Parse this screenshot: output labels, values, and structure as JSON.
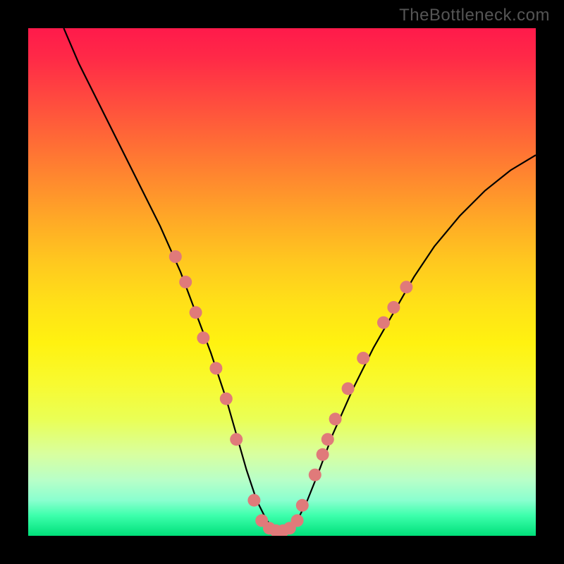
{
  "watermark": "TheBottleneck.com",
  "colors": {
    "curve_stroke": "#000000",
    "marker_fill": "#e07a7a",
    "marker_stroke": "#c86060",
    "frame_bg": "#000000"
  },
  "chart_data": {
    "type": "line",
    "title": "",
    "xlabel": "",
    "ylabel": "",
    "xlim": [
      0,
      100
    ],
    "ylim": [
      0,
      100
    ],
    "series": [
      {
        "name": "curve",
        "x": [
          7,
          10,
          14,
          18,
          22,
          26,
          30,
          33,
          36,
          39,
          41,
          43,
          45,
          47,
          49,
          51,
          53,
          55,
          57,
          60,
          64,
          68,
          72,
          76,
          80,
          85,
          90,
          95,
          100
        ],
        "values": [
          100,
          93,
          85,
          77,
          69,
          61,
          52,
          44,
          36,
          27,
          20,
          13,
          7,
          3,
          1,
          1,
          3,
          7,
          12,
          20,
          29,
          37,
          44,
          51,
          57,
          63,
          68,
          72,
          75
        ]
      }
    ],
    "markers": [
      {
        "x": 29,
        "y": 55
      },
      {
        "x": 31,
        "y": 50
      },
      {
        "x": 33,
        "y": 44
      },
      {
        "x": 34.5,
        "y": 39
      },
      {
        "x": 37,
        "y": 33
      },
      {
        "x": 39,
        "y": 27
      },
      {
        "x": 41,
        "y": 19
      },
      {
        "x": 44.5,
        "y": 7
      },
      {
        "x": 46,
        "y": 3
      },
      {
        "x": 47.5,
        "y": 1.5
      },
      {
        "x": 48.8,
        "y": 1
      },
      {
        "x": 50.2,
        "y": 1
      },
      {
        "x": 51.5,
        "y": 1.5
      },
      {
        "x": 53,
        "y": 3
      },
      {
        "x": 54,
        "y": 6
      },
      {
        "x": 56.5,
        "y": 12
      },
      {
        "x": 58,
        "y": 16
      },
      {
        "x": 59,
        "y": 19
      },
      {
        "x": 60.5,
        "y": 23
      },
      {
        "x": 63,
        "y": 29
      },
      {
        "x": 66,
        "y": 35
      },
      {
        "x": 70,
        "y": 42
      },
      {
        "x": 72,
        "y": 45
      },
      {
        "x": 74.5,
        "y": 49
      }
    ]
  }
}
